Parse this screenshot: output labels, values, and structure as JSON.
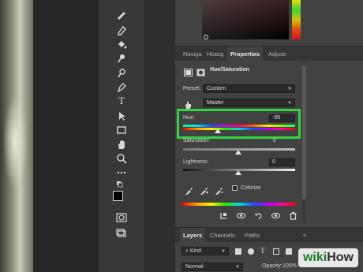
{
  "tabs": [
    "Naviga",
    "Histog",
    "Properties",
    "Adjustr"
  ],
  "properties": {
    "title": "Hue/Saturation",
    "preset_label": "Preset:",
    "preset_value": "Custom",
    "channel_value": "Master",
    "hue_label": "Hue:",
    "hue_value": "-35",
    "hue_thumb_fraction": 0.31,
    "saturation_label": "Saturation:",
    "saturation_value": "0",
    "lightness_label": "Lightness:",
    "lightness_value": "0",
    "colorize_label": "Colorize"
  },
  "layers_tabs": [
    "Layers",
    "Channels",
    "Paths"
  ],
  "layers": {
    "kind_value": "Kind",
    "blend_mode": "Normal",
    "opacity_label": "Opacity:",
    "opacity_value": "100%"
  },
  "watermark": {
    "wiki": "wiki",
    "how": "How"
  },
  "colors": {
    "highlight": "#2ed63a",
    "panel": "#424242",
    "toolbar": "#383838"
  }
}
